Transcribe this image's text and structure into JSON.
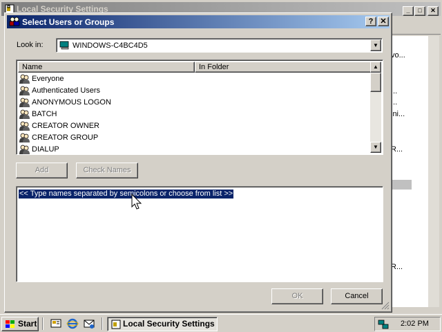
{
  "background_window": {
    "title": "Local Security Settings",
    "fragments": [
      "vo...",
      "...",
      "...",
      "ini...",
      "R...",
      "R..."
    ]
  },
  "dialog": {
    "title": "Select Users or Groups",
    "help_label": "?",
    "close_label": "✕",
    "look_in_label": "Look in:",
    "look_in_value": "WINDOWS-C4BC4D5",
    "columns": [
      "Name",
      "In Folder"
    ],
    "items": [
      {
        "name": "Everyone"
      },
      {
        "name": "Authenticated Users"
      },
      {
        "name": "ANONYMOUS LOGON"
      },
      {
        "name": "BATCH"
      },
      {
        "name": "CREATOR OWNER"
      },
      {
        "name": "CREATOR GROUP"
      },
      {
        "name": "DIALUP"
      }
    ],
    "add_label": "Add",
    "check_names_label": "Check Names",
    "names_placeholder": "<< Type names separated by semicolons or choose from list >>",
    "ok_label": "OK",
    "cancel_label": "Cancel"
  },
  "taskbar": {
    "start_label": "Start",
    "task_label": "Local Security Settings",
    "clock": "2:02 PM"
  },
  "colors": {
    "title_active": "#0a246a",
    "title_gradient_end": "#a6caf0",
    "face": "#d4d0c8"
  }
}
